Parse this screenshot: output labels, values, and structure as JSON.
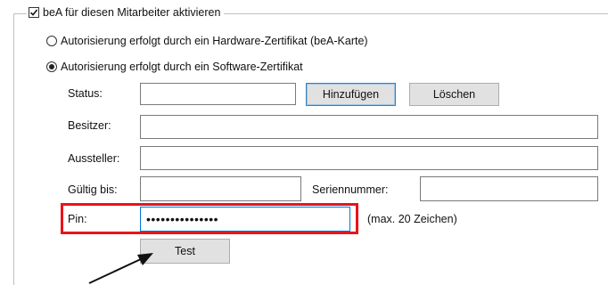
{
  "group": {
    "checkbox_label": "beA für diesen Mitarbeiter aktivieren",
    "checked": true
  },
  "auth_options": [
    {
      "label": "Autorisierung erfolgt durch ein Hardware-Zertifikat (beA-Karte)",
      "selected": false
    },
    {
      "label": "Autorisierung erfolgt durch ein Software-Zertifikat",
      "selected": true
    }
  ],
  "form": {
    "status_label": "Status:",
    "status_value": "",
    "add_button": "Hinzufügen",
    "delete_button": "Löschen",
    "owner_label": "Besitzer:",
    "owner_value": "",
    "issuer_label": "Aussteller:",
    "issuer_value": "",
    "valid_until_label": "Gültig bis:",
    "valid_until_value": "",
    "serial_label": "Seriennummer:",
    "serial_value": "",
    "pin_label": "Pin:",
    "pin_value": "•••••••••••••••",
    "pin_hint": "(max. 20 Zeichen)",
    "test_button": "Test"
  },
  "colors": {
    "highlight": "#e8141b",
    "focus_border": "#0078d7",
    "button_bg": "#e1e1e1"
  }
}
